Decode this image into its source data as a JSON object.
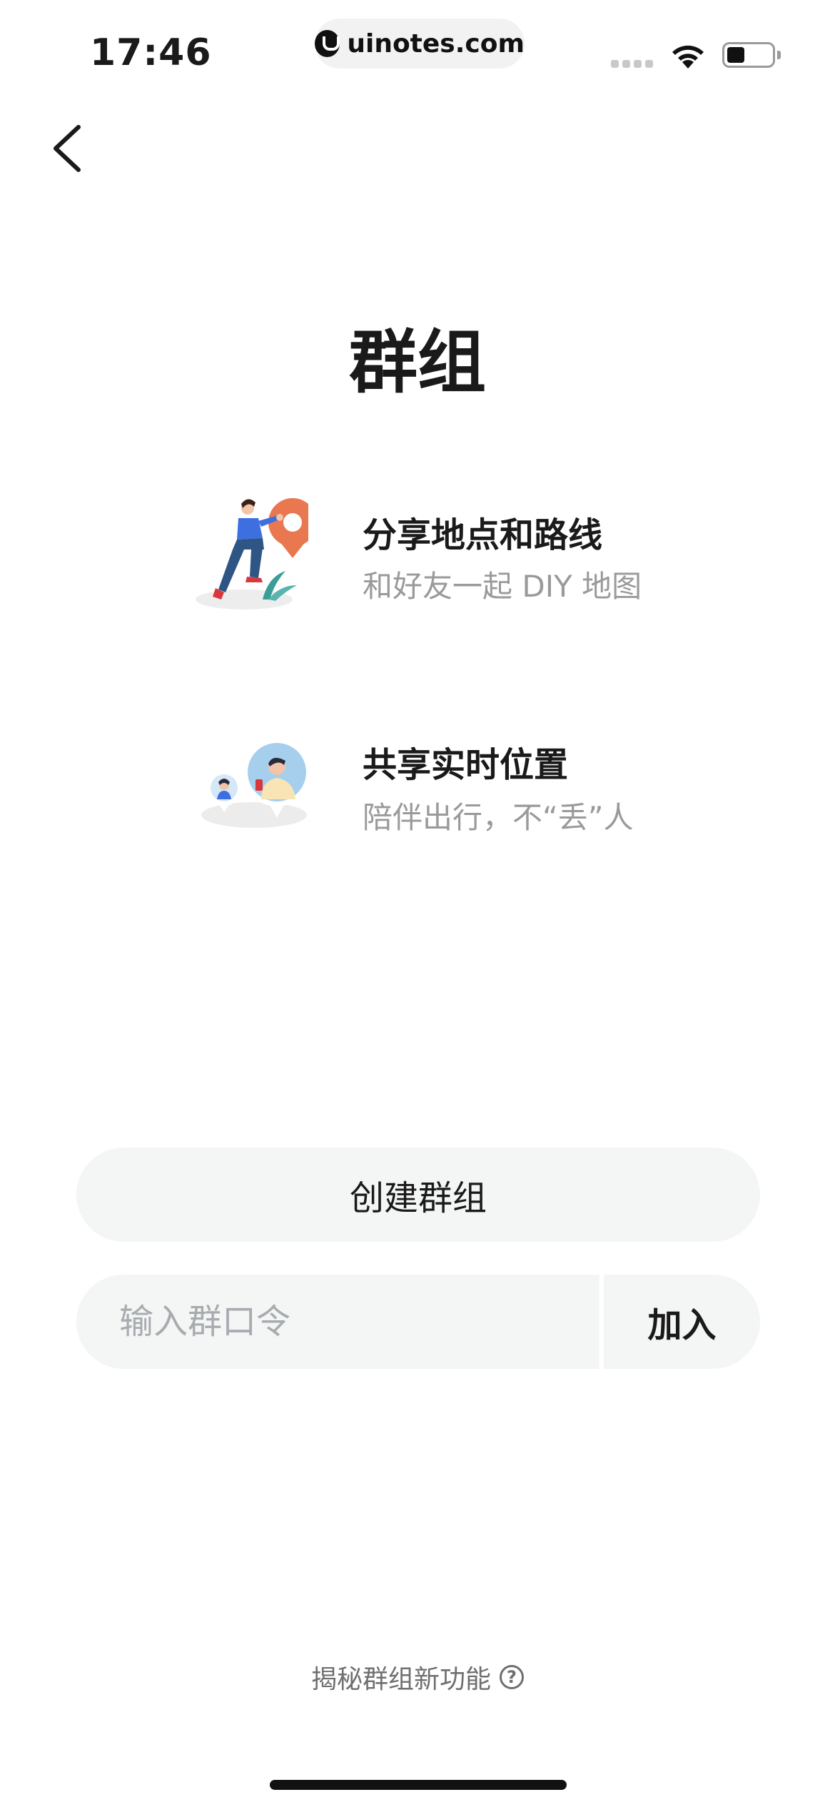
{
  "status_bar": {
    "time": "17:46",
    "url": "uinotes.com"
  },
  "page": {
    "title": "群组"
  },
  "features": [
    {
      "title": "分享地点和路线",
      "subtitle": "和好友一起 DIY 地图",
      "icon": "map-pin-illustration"
    },
    {
      "title": "共享实时位置",
      "subtitle": "陪伴出行，不“丢”人",
      "icon": "live-location-illustration"
    }
  ],
  "actions": {
    "create_label": "创建群组",
    "code_placeholder": "输入群口令",
    "join_label": "加入"
  },
  "footer": {
    "link_label": "揭秘群组新功能",
    "help_icon_glyph": "?"
  },
  "colors": {
    "accent_orange": "#e9774f",
    "button_bg": "#f4f6f5"
  }
}
